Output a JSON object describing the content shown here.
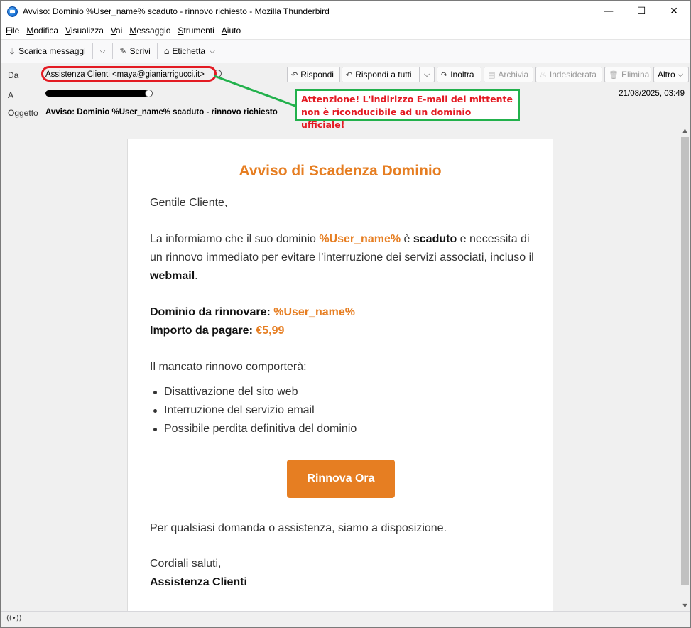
{
  "window": {
    "title": "Avviso: Dominio %User_name% scaduto - rinnovo richiesto - Mozilla Thunderbird",
    "minimize": "—",
    "maximize": "☐",
    "close": "✕"
  },
  "menubar": {
    "items": [
      {
        "first": "F",
        "rest": "ile"
      },
      {
        "first": "M",
        "rest": "odifica"
      },
      {
        "first": "V",
        "rest": "isualizza"
      },
      {
        "first": "V",
        "rest": "ai"
      },
      {
        "first": "M",
        "rest": "essaggio"
      },
      {
        "first": "S",
        "rest": "trumenti"
      },
      {
        "first": "A",
        "rest": "iuto"
      }
    ]
  },
  "toolbar": {
    "get_messages": "Scarica messaggi",
    "get_messages_icon": "⇩",
    "write": "Scrivi",
    "write_icon": "✎",
    "tag": "Etichetta",
    "tag_icon": "⌂",
    "chevron": "⌵"
  },
  "header": {
    "from_label": "Da",
    "to_label": "A",
    "subject_label": "Oggetto",
    "from_value": "Assistenza Clienti <maya@gianiarrigucci.it>",
    "subject_value": "Avviso: Dominio %User_name% scaduto - rinnovo richiesto",
    "date_value": "21/08/2025, 03:49",
    "buttons": {
      "reply": "Rispondi",
      "reply_all": "Rispondi a tutti",
      "forward": "Inoltra",
      "archive": "Archivia",
      "junk": "Indesiderata",
      "delete": "Elimina",
      "more": "Altro"
    },
    "icons": {
      "reply": "↶",
      "reply_all": "↶",
      "forward": "↷",
      "archive": "▤",
      "junk": "♨",
      "delete": "🗑",
      "dropdown": "⌵"
    }
  },
  "warning": {
    "line1": "Attenzione! L'indirizzo E-mail del mittente",
    "line2": "non è riconducibile ad un dominio ufficiale!"
  },
  "email": {
    "title": "Avviso di Scadenza Dominio",
    "greeting": "Gentile Cliente,",
    "intro_1": "La informiamo che il suo dominio ",
    "intro_domain": "%User_name%",
    "intro_2": " è ",
    "intro_bold": "scaduto",
    "intro_3": " e necessita di un rinnovo immediato per evitare l’interruzione dei servizi associati, incluso il ",
    "intro_webmail": "webmail",
    "intro_4": ".",
    "domain_label": "Dominio da rinnovare:",
    "domain_value": "%User_name%",
    "amount_label": "Importo da pagare:",
    "amount_value": "€5,99",
    "consequences_intro": "Il mancato rinnovo comporterà:",
    "consequences": [
      "Disattivazione del sito web",
      "Interruzione del servizio email",
      "Possibile perdita definitiva del dominio"
    ],
    "cta": "Rinnova Ora",
    "assistance": "Per qualsiasi domanda o assistenza, siamo a disposizione.",
    "closing": "Cordiali saluti,",
    "signature": "Assistenza Clienti"
  },
  "statusbar": {
    "icon": "((•))"
  },
  "colors": {
    "accent_orange": "#e67e22",
    "warning_red": "#e31b23",
    "annotation_green": "#22b14c"
  }
}
